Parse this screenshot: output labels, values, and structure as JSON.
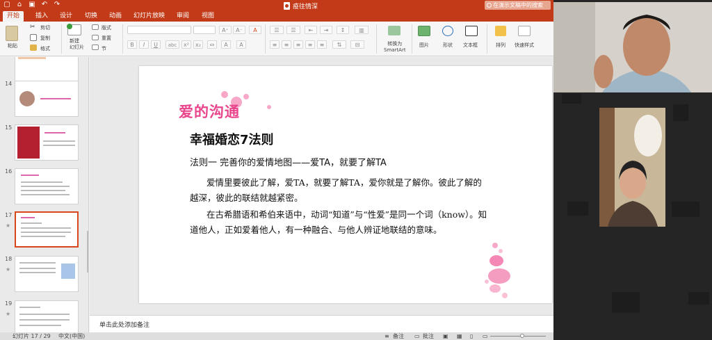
{
  "window": {
    "title": "疫往情深"
  },
  "search": {
    "placeholder": "在演示文稿中的搜索"
  },
  "tabs": [
    {
      "label": "开始",
      "active": true
    },
    {
      "label": "插入"
    },
    {
      "label": "设计"
    },
    {
      "label": "切换"
    },
    {
      "label": "动画"
    },
    {
      "label": "幻灯片放映"
    },
    {
      "label": "审阅"
    },
    {
      "label": "视图"
    }
  ],
  "ribbon": {
    "paste": "粘贴",
    "cut": "剪切",
    "copy": "复制",
    "format": "格式",
    "new_slide": "新建\n幻灯片",
    "layout": "版式",
    "reset": "重置",
    "section": "节",
    "convert_smartart": "转换为\nSmartArt",
    "picture": "图片",
    "shape": "形状",
    "textbox": "文本框",
    "arrange": "排列",
    "quick_styles": "快速样式"
  },
  "thumbnails": [
    {
      "num": "14"
    },
    {
      "num": "15"
    },
    {
      "num": "16"
    },
    {
      "num": "17",
      "selected": true
    },
    {
      "num": "18"
    },
    {
      "num": "19"
    }
  ],
  "slide": {
    "brand": "爱的沟通",
    "heading": "幸福婚恋7法则",
    "rule": "法则一 完善你的爱情地图——爱TA，就要了解TA",
    "para1": "爱情里要彼此了解，爱TA，就要了解TA，爱你就是了解你。彼此了解的越深，彼此的联结就越紧密。",
    "para2": "在古希腊语和希伯来语中，动词“知道”与“性爱”是同一个词（know）。知道他人，正如爱着他人，有一种融合、与他人辨证地联结的意味。"
  },
  "notes": {
    "placeholder": "单击此处添加备注"
  },
  "statusbar": {
    "slide_counter": "幻灯片 17 / 29",
    "language": "中文(中国)",
    "notes_btn": "备注",
    "comments_btn": "批注"
  },
  "colors": {
    "ppt_accent": "#c23a17",
    "brand_pink": "#e9458c"
  }
}
